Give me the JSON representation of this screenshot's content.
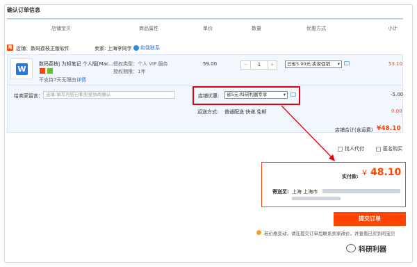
{
  "page": {
    "title": "确认订单信息"
  },
  "columns": [
    "店铺宝贝",
    "商品属性",
    "单价",
    "数量",
    "优惠方式",
    "小计"
  ],
  "shop": {
    "icon_text": "淘",
    "name": "店铺：数码荔枝正版软件",
    "seller": "卖家: 上海李同学",
    "contact_label": "和我联系"
  },
  "item": {
    "name": "数码荔枝| 为知笔记 个人版[Mac...",
    "not_support": "不支持7天无理由",
    "detail_link": "详情",
    "attr1": "授权类型：个人 VIP 服务",
    "attr2": "授权期限：1年",
    "price": "59.00",
    "qty": "1",
    "qty_minus": "−",
    "qty_plus": "+",
    "discount_select": "已省5.90元:卖家促销",
    "subtotal": "53.10"
  },
  "message": {
    "label": "给卖家留言：",
    "placeholder": "选填:填写内容已和卖家协商确认"
  },
  "shop_discount": {
    "label": "店铺优惠:",
    "select": "省5元:科研利器专享",
    "amount": "-5.00"
  },
  "shipping": {
    "label": "运送方式:",
    "value": "普通配送 快递 免邮",
    "amount": "0.00"
  },
  "shop_total": {
    "label": "店铺合计(含运费)",
    "value": "¥48.10"
  },
  "options": {
    "proxy_pay": "找人代付",
    "anonymous": "匿名购买"
  },
  "payment": {
    "label": "实付款:",
    "currency": "¥",
    "amount": "48.10",
    "address_label": "寄送至:",
    "address_city": "上海 上海市"
  },
  "submit_label": "提交订单",
  "notice": "若价格变动，请在提交订单后联系卖家改价，并查看已买到的宝贝",
  "watermark": "科研利器",
  "colors": {
    "accent": "#ff4400",
    "annotation": "#e4000f"
  }
}
